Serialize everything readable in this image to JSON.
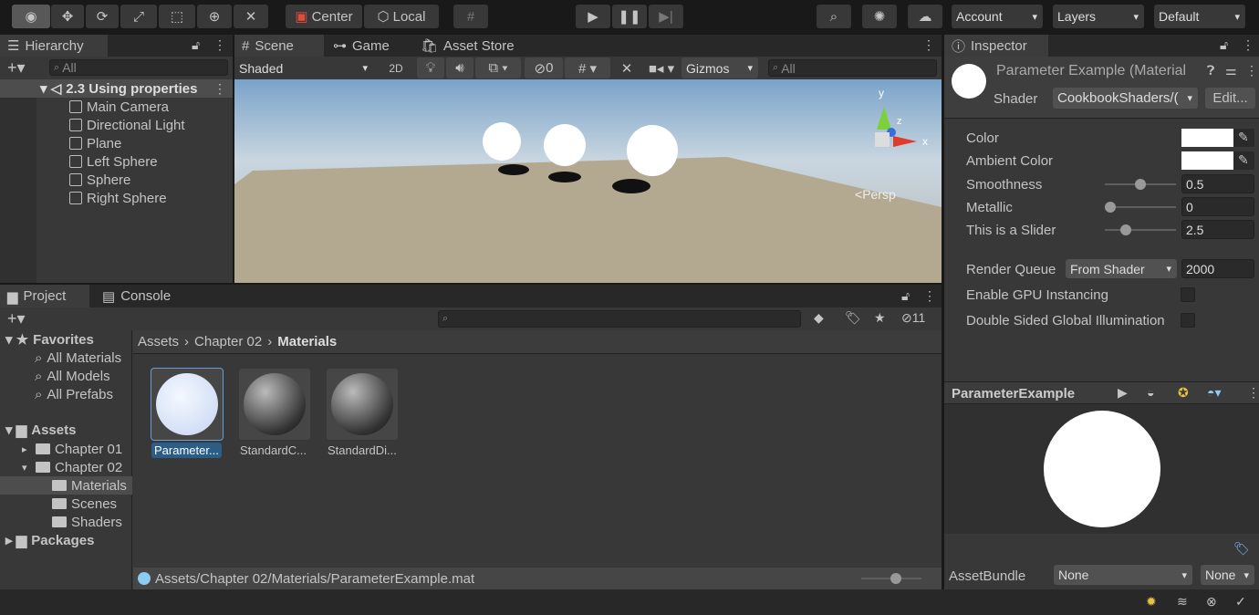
{
  "toolbar": {
    "tools": [
      "view-tool",
      "move-tool",
      "rotate-tool",
      "scale-tool",
      "rect-tool",
      "transform-tool",
      "custom-tool"
    ],
    "pivot": "Center",
    "space": "Local",
    "account": "Account",
    "layers": "Layers",
    "layout": "Default"
  },
  "hierarchy": {
    "tab": "Hierarchy",
    "search_placeholder": "All",
    "scene": "2.3 Using properties",
    "items": [
      "Main Camera",
      "Directional Light",
      "Plane",
      "Left Sphere",
      "Sphere",
      "Right Sphere"
    ]
  },
  "scene": {
    "tabs": [
      "Scene",
      "Game",
      "Asset Store"
    ],
    "shading": "Shaded",
    "mode2d": "2D",
    "hidden_count": "0",
    "gizmos": "Gizmos",
    "search_placeholder": "All",
    "persp": "Persp",
    "axis_x": "x",
    "axis_y": "y",
    "axis_z": "z"
  },
  "project": {
    "tabs": [
      "Project",
      "Console"
    ],
    "hidden_count": "11",
    "favorites": {
      "label": "Favorites",
      "items": [
        "All Materials",
        "All Models",
        "All Prefabs"
      ]
    },
    "assets": {
      "label": "Assets",
      "items": [
        "Chapter 01",
        "Chapter 02",
        "Materials",
        "Scenes",
        "Shaders"
      ]
    },
    "packages": "Packages",
    "breadcrumb": [
      "Assets",
      "Chapter 02",
      "Materials"
    ],
    "files": [
      "Parameter...",
      "StandardC...",
      "StandardDi..."
    ],
    "status_path": "Assets/Chapter 02/Materials/ParameterExample.mat"
  },
  "inspector": {
    "tab": "Inspector",
    "title": "Parameter Example (Material",
    "shader_label": "Shader",
    "shader": "CookbookShaders/(",
    "edit": "Edit...",
    "props": {
      "color": "Color",
      "ambient": "Ambient Color",
      "smoothness": "Smoothness",
      "smoothness_val": "0.5",
      "metallic": "Metallic",
      "metallic_val": "0",
      "slider": "This is a Slider",
      "slider_val": "2.5"
    },
    "slider_fractions": {
      "smoothness": 0.5,
      "metallic": 0,
      "slider": 0.25
    },
    "render_queue_label": "Render Queue",
    "render_queue_mode": "From Shader",
    "render_queue": "2000",
    "gpu_instancing": "Enable GPU Instancing",
    "double_sided": "Double Sided Global Illumination",
    "preview_title": "ParameterExample",
    "asset_bundle_label": "AssetBundle",
    "asset_bundle": "None",
    "variant": "None"
  },
  "colors": {
    "accent": "#2c5d87",
    "panel": "#383838",
    "selected": "#4d4d4d"
  }
}
